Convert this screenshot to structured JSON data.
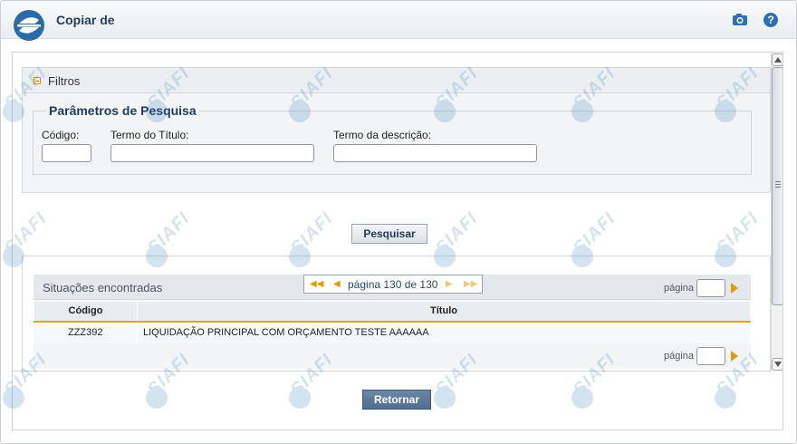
{
  "window": {
    "title": "Copiar de"
  },
  "icons": {
    "logo": "siafi-logo-icon",
    "camera": "camera-icon",
    "help": "help-icon",
    "help_glyph": "?"
  },
  "filters": {
    "label": "Filtros",
    "legend": "Parâmetros de Pesquisa",
    "fields": {
      "codigo_label": "Código:",
      "titulo_label": "Termo do Título:",
      "descricao_label": "Termo da descrição:",
      "codigo_value": "",
      "titulo_value": "",
      "descricao_value": ""
    }
  },
  "search_button": "Pesquisar",
  "results": {
    "title": "Situações encontradas",
    "pager_text": "página 130 de 130",
    "page_label": "página",
    "columns": [
      "Código",
      "Título"
    ],
    "rows": [
      {
        "codigo": "ZZZ392",
        "titulo": "LIQUIDAÇÃO PRINCIPAL COM ORÇAMENTO TESTE AAAAAA"
      }
    ]
  },
  "return_button": "Retornar",
  "watermark": "SIAFI",
  "colors": {
    "accent": "#1f3c5c",
    "pager_arrow": "#e09a10",
    "return_button": "#5a7899"
  }
}
